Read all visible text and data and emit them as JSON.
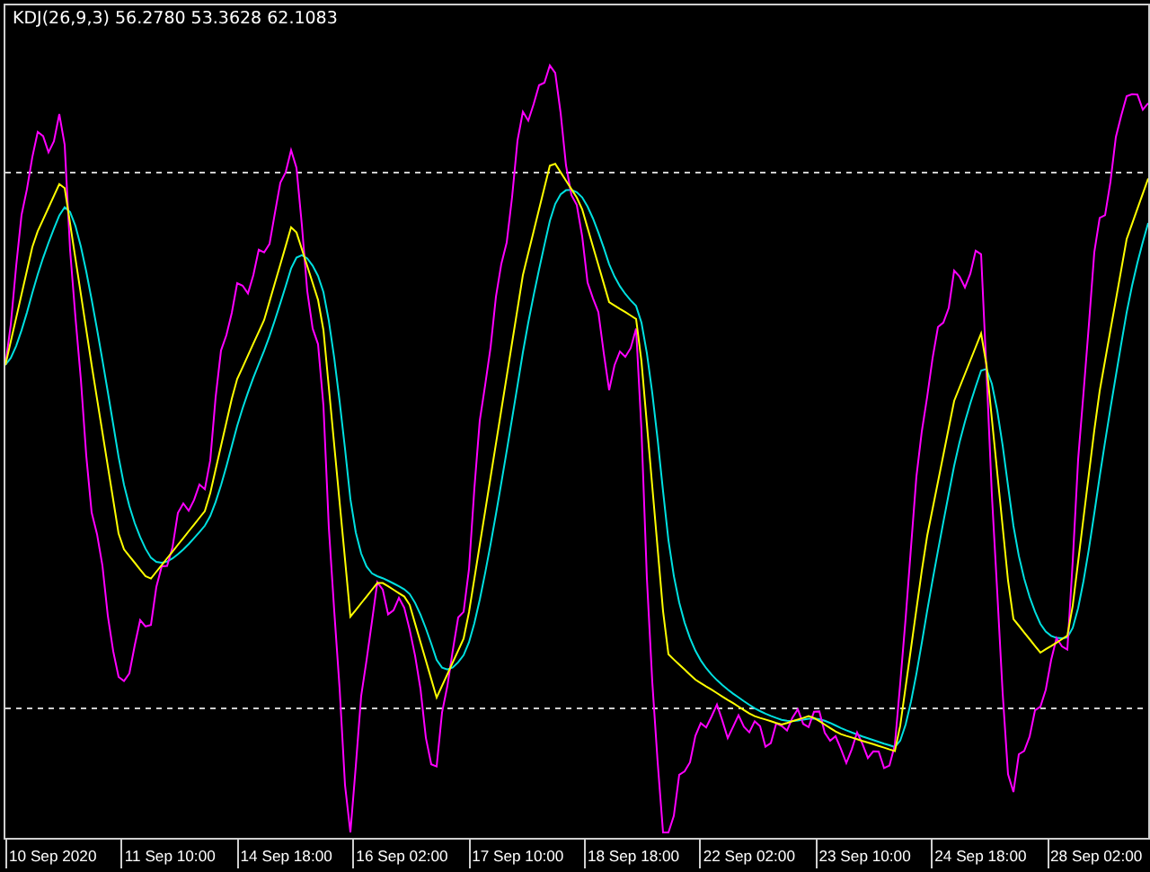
{
  "indicator": {
    "label": "KDJ(26,9,3) 56.2780 53.3628 62.1083"
  },
  "time_axis": {
    "labels": [
      "10 Sep 2020",
      "11 Sep 10:00",
      "14 Sep 18:00",
      "16 Sep 02:00",
      "17 Sep 10:00",
      "18 Sep 18:00",
      "22 Sep 02:00",
      "23 Sep 10:00",
      "24 Sep 18:00",
      "28 Sep 02:00"
    ]
  }
}
